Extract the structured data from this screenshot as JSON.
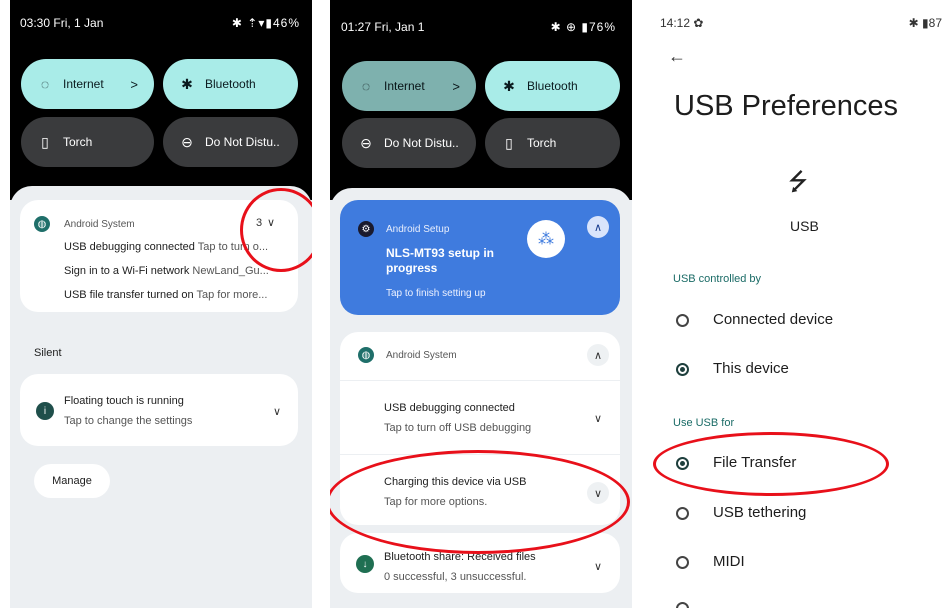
{
  "panel1": {
    "status_time": "03:30 Fri, 1 Jan",
    "status_right": "✱ ⇡▾▮46%",
    "tiles": [
      {
        "label": "Internet",
        "icon": "wifi-icon",
        "glyph": "◌",
        "arrow": ">"
      },
      {
        "label": "Bluetooth",
        "icon": "bluetooth-icon",
        "glyph": "✱"
      },
      {
        "label": "Torch",
        "icon": "torch-icon",
        "glyph": "▯"
      },
      {
        "label": "Do Not Distu..",
        "icon": "do-not-disturb-icon",
        "glyph": "⊖"
      }
    ],
    "notif": {
      "app": "Android System",
      "count": "3",
      "count_chevron": "∨",
      "lines": [
        {
          "title": "USB debugging connected",
          "text": " Tap to turn o..."
        },
        {
          "title": "Sign in to a Wi-Fi network",
          "text": " NewLand_Gu..."
        },
        {
          "title": "USB file transfer turned on",
          "text": " Tap for more..."
        }
      ]
    },
    "silent_label": "Silent",
    "floating": {
      "title": "Floating touch is running",
      "text": "Tap to change the settings",
      "chevron": "∨"
    },
    "manage_label": "Manage"
  },
  "panel2": {
    "status_time": "01:27 Fri, Jan 1",
    "status_right": "✱ ⊕ ▮76%",
    "tiles": [
      {
        "label": "Internet",
        "icon": "wifi-icon",
        "glyph": "◌",
        "arrow": ">"
      },
      {
        "label": "Bluetooth",
        "icon": "bluetooth-icon",
        "glyph": "✱"
      },
      {
        "label": "Do Not Distu..",
        "icon": "do-not-disturb-icon",
        "glyph": "⊖"
      },
      {
        "label": "Torch",
        "icon": "torch-icon",
        "glyph": "▯"
      }
    ],
    "setup": {
      "app": "Android Setup",
      "title": "NLS-MT93 setup in progress",
      "text": "Tap to finish setting up",
      "chevron": "∧"
    },
    "system": {
      "app": "Android System",
      "chevron": "∧",
      "items": [
        {
          "title": "USB debugging connected",
          "text": "Tap to turn off USB debugging",
          "chevron": "∨"
        },
        {
          "title": "Charging this device via USB",
          "text": "Tap for more options.",
          "chevron": "∨"
        }
      ]
    },
    "bluetooth_share": {
      "title": "Bluetooth share: Received files",
      "text": "0 successful, 3 unsuccessful.",
      "chevron": "∨"
    }
  },
  "panel3": {
    "status_time": "14:12 ✿",
    "status_right": "✱ ▮87",
    "back": "←",
    "page_title": "USB Preferences",
    "usb_glyph": "⭍",
    "usb_label": "USB",
    "controlled_by_header": "USB controlled by",
    "controlled_options": [
      {
        "label": "Connected device",
        "selected": false
      },
      {
        "label": "This device",
        "selected": true
      }
    ],
    "use_for_header": "Use USB for",
    "use_options": [
      {
        "label": "File Transfer",
        "selected": true
      },
      {
        "label": "USB tethering",
        "selected": false
      },
      {
        "label": "MIDI",
        "selected": false
      }
    ]
  }
}
